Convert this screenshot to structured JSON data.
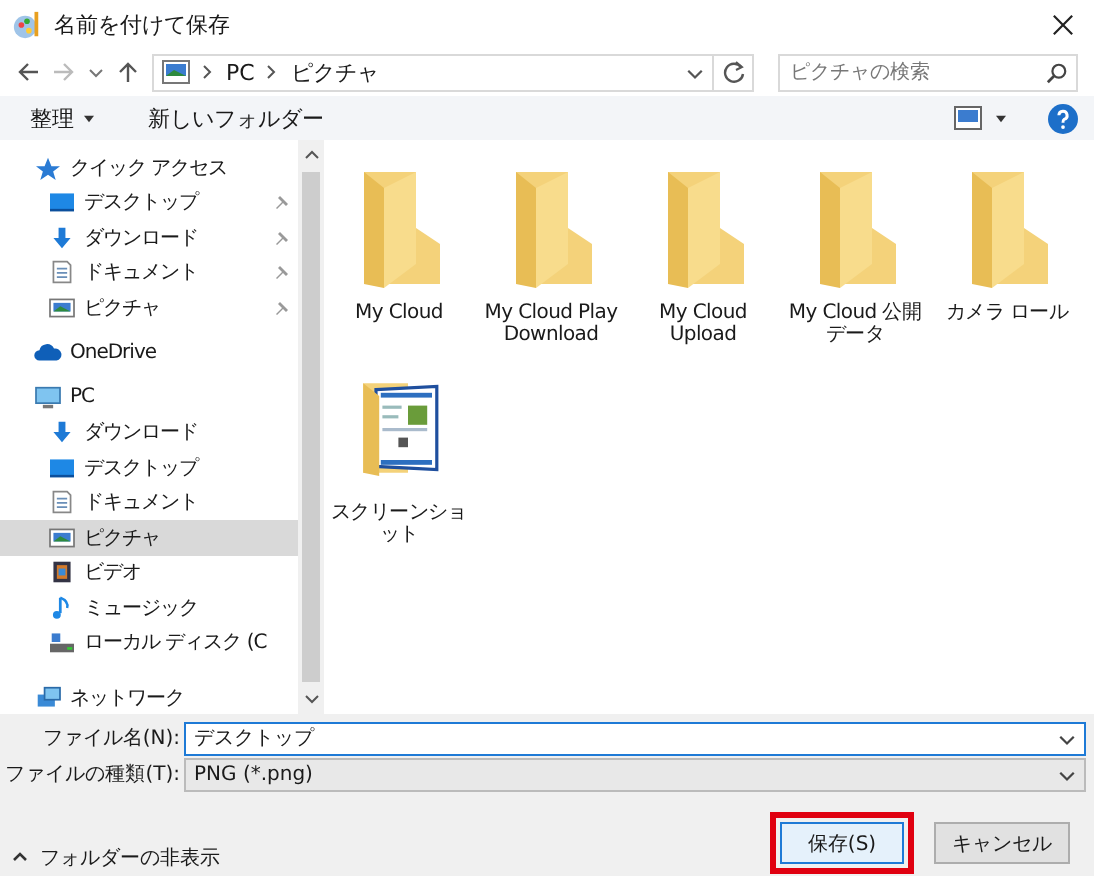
{
  "window": {
    "title": "名前を付けて保存"
  },
  "address": {
    "crumbs": [
      "PC",
      "ピクチャ"
    ]
  },
  "search": {
    "placeholder": "ピクチャの検索"
  },
  "toolbar": {
    "organize": "整理",
    "new_folder": "新しいフォルダー"
  },
  "sidebar": {
    "groups": [
      {
        "label": "クイック アクセス",
        "kind": "star",
        "selected": false,
        "children": [
          {
            "label": "デスクトップ",
            "kind": "desktop",
            "pinned": true,
            "selected": false
          },
          {
            "label": "ダウンロード",
            "kind": "download",
            "pinned": true,
            "selected": false
          },
          {
            "label": "ドキュメント",
            "kind": "document",
            "pinned": true,
            "selected": false
          },
          {
            "label": "ピクチャ",
            "kind": "pictures",
            "pinned": true,
            "selected": false
          }
        ]
      },
      {
        "label": "OneDrive",
        "kind": "cloud",
        "selected": false
      },
      {
        "label": "PC",
        "kind": "pc",
        "selected": false,
        "children": [
          {
            "label": "ダウンロード",
            "kind": "download",
            "pinned": false,
            "selected": false
          },
          {
            "label": "デスクトップ",
            "kind": "desktop",
            "pinned": false,
            "selected": false
          },
          {
            "label": "ドキュメント",
            "kind": "document",
            "pinned": false,
            "selected": false
          },
          {
            "label": "ピクチャ",
            "kind": "pictures",
            "pinned": false,
            "selected": true
          },
          {
            "label": "ビデオ",
            "kind": "video",
            "pinned": false,
            "selected": false
          },
          {
            "label": "ミュージック",
            "kind": "music",
            "pinned": false,
            "selected": false
          },
          {
            "label": "ローカル ディスク (C",
            "kind": "drive",
            "pinned": false,
            "selected": false
          }
        ]
      }
    ],
    "bottom": {
      "label": "ネットワーク",
      "kind": "network",
      "selected": false
    }
  },
  "folders": [
    {
      "name": "My Cloud",
      "kind": "folder"
    },
    {
      "name": "My Cloud Play Download",
      "kind": "folder"
    },
    {
      "name": "My Cloud Upload",
      "kind": "folder"
    },
    {
      "name": "My Cloud 公開データ",
      "kind": "folder"
    },
    {
      "name": "カメラ ロール",
      "kind": "folder"
    },
    {
      "name": "スクリーンショット",
      "kind": "thumbnail-folder"
    }
  ],
  "fields": [
    {
      "label": "ファイル名(N):",
      "value": "デスクトップ",
      "editable": true
    },
    {
      "label": "ファイルの種類(T):",
      "value": "PNG (*.png)",
      "editable": false
    }
  ],
  "hide_folders": "フォルダーの非表示",
  "buttons": [
    {
      "label": "保存(S)",
      "highlighted": true
    },
    {
      "label": "キャンセル",
      "highlighted": false
    }
  ]
}
